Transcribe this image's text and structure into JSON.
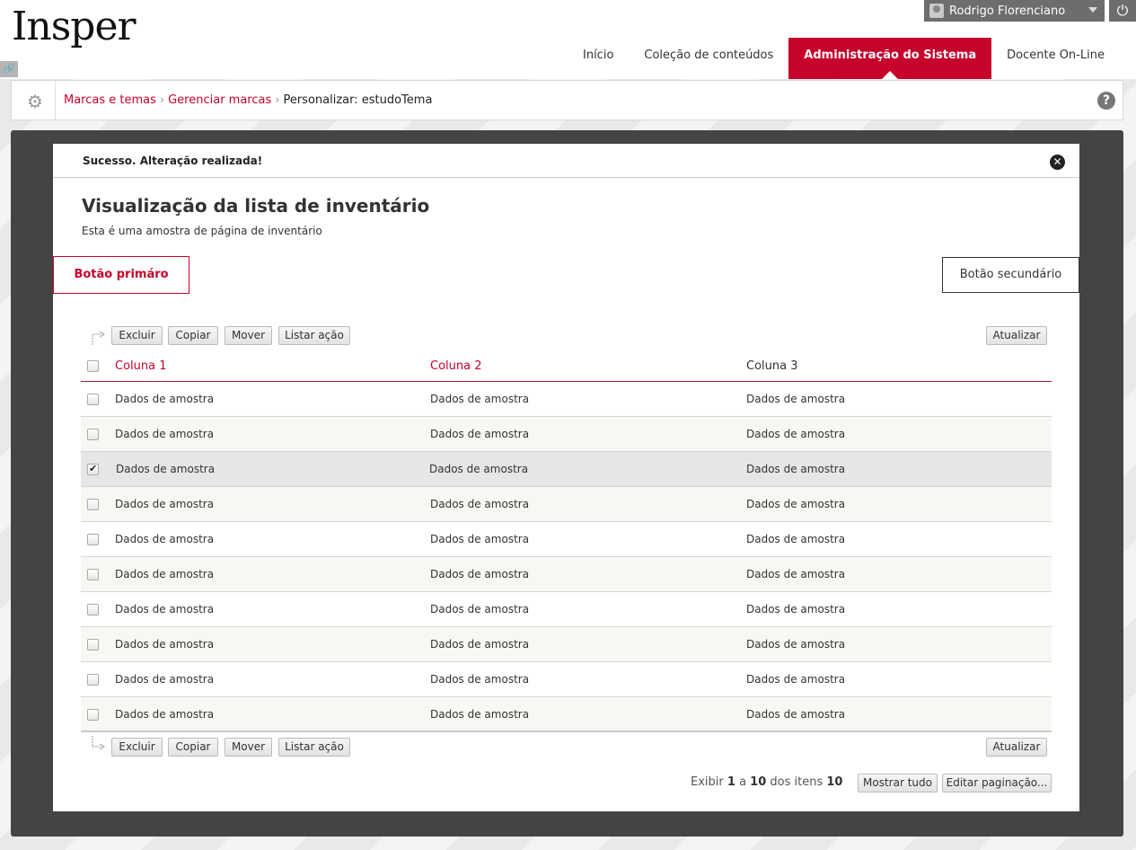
{
  "brand": {
    "logo": "Insper",
    "accent": "#c5032b"
  },
  "user": {
    "name": "Rodrigo Florenciano"
  },
  "nav": {
    "items": [
      {
        "label": "Início"
      },
      {
        "label": "Coleção de conteúdos"
      },
      {
        "label": "Administração do Sistema",
        "active": true
      },
      {
        "label": "Docente On-Line"
      }
    ]
  },
  "breadcrumb": {
    "items": [
      "Marcas e temas",
      "Gerenciar marcas"
    ],
    "current": "Personalizar: estudoTema"
  },
  "message": {
    "text": "Sucesso. Alteração realizada!"
  },
  "page": {
    "title": "Visualização da lista de inventário",
    "subtitle": "Esta é uma amostra de página de inventário"
  },
  "buttons": {
    "primary": "Botão primáro",
    "secondary": "Botão secundário"
  },
  "actions": {
    "delete": "Excluir",
    "copy": "Copiar",
    "move": "Mover",
    "list_action": "Listar ação",
    "refresh": "Atualizar"
  },
  "table": {
    "columns": [
      "Coluna 1",
      "Coluna 2",
      "Coluna 3"
    ],
    "rows": [
      {
        "cells": [
          "Dados de amostra",
          "Dados de amostra",
          "Dados de amostra"
        ],
        "checked": false
      },
      {
        "cells": [
          "Dados de amostra",
          "Dados de amostra",
          "Dados de amostra"
        ],
        "checked": false
      },
      {
        "cells": [
          "Dados de amostra",
          "Dados de amostra",
          "Dados de amostra"
        ],
        "checked": true
      },
      {
        "cells": [
          "Dados de amostra",
          "Dados de amostra",
          "Dados de amostra"
        ],
        "checked": false
      },
      {
        "cells": [
          "Dados de amostra",
          "Dados de amostra",
          "Dados de amostra"
        ],
        "checked": false
      },
      {
        "cells": [
          "Dados de amostra",
          "Dados de amostra",
          "Dados de amostra"
        ],
        "checked": false
      },
      {
        "cells": [
          "Dados de amostra",
          "Dados de amostra",
          "Dados de amostra"
        ],
        "checked": false
      },
      {
        "cells": [
          "Dados de amostra",
          "Dados de amostra",
          "Dados de amostra"
        ],
        "checked": false
      },
      {
        "cells": [
          "Dados de amostra",
          "Dados de amostra",
          "Dados de amostra"
        ],
        "checked": false
      },
      {
        "cells": [
          "Dados de amostra",
          "Dados de amostra",
          "Dados de amostra"
        ],
        "checked": false
      }
    ]
  },
  "pagination": {
    "show": "Exibir",
    "from": "1",
    "to_word": "a",
    "to": "10",
    "of_items": "dos itens",
    "total": "10",
    "show_all": "Mostrar tudo",
    "edit": "Editar paginação..."
  }
}
